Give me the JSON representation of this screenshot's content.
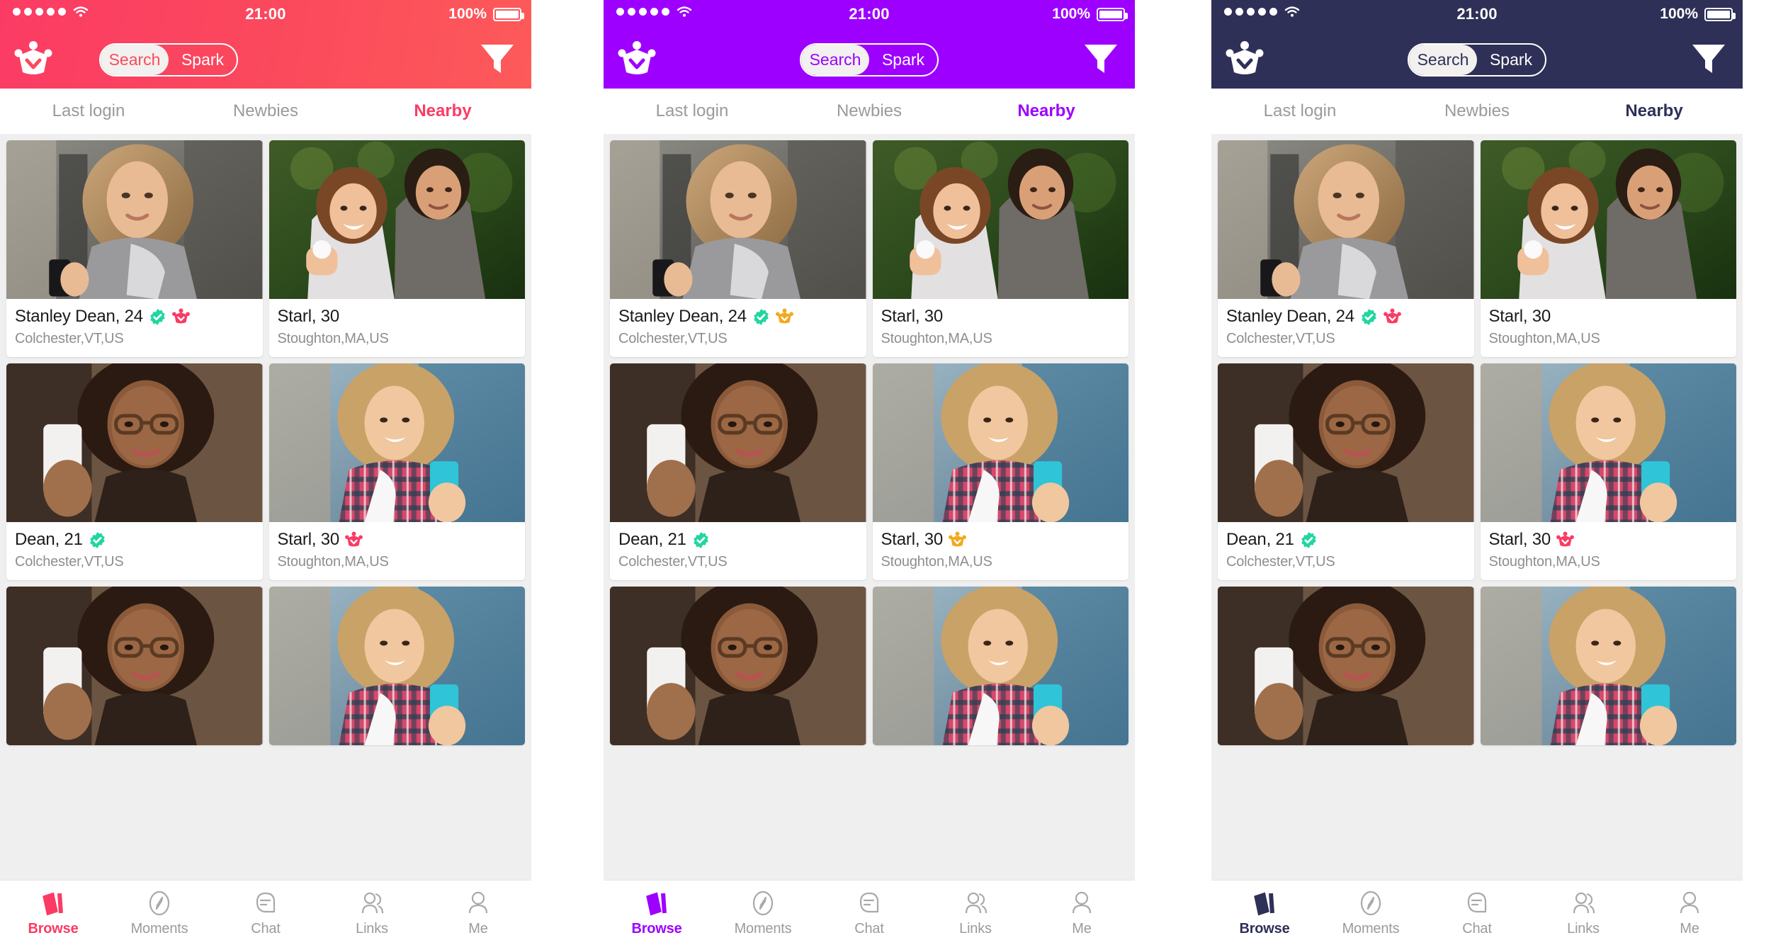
{
  "panels": [
    {
      "theme_name": "pink",
      "accent": "#fb3b64",
      "header_bg": "#fb4a5c",
      "crown_badge_color": "#fb3b64",
      "status": {
        "time": "21:00",
        "battery_percent": "100%",
        "signal_dots": 5,
        "wifi": "wifi-icon"
      },
      "navbar": {
        "logo": "crown-logo-icon",
        "filter": "filter-funnel-icon",
        "segments": [
          {
            "label": "Search",
            "selected": true
          },
          {
            "label": "Spark",
            "selected": false
          }
        ]
      },
      "tabs": [
        {
          "label": "Last login",
          "active": false
        },
        {
          "label": "Newbies",
          "active": false
        },
        {
          "label": "Nearby",
          "active": true
        }
      ],
      "cards": [
        {
          "name": "Stanley Dean, 24",
          "location": "Colchester,VT,US",
          "badges": [
            "verified",
            "crown"
          ],
          "photo": "woman-scarf-phone"
        },
        {
          "name": "Starl, 30",
          "location": "Stoughton,MA,US",
          "badges": [],
          "photo": "couple-hug"
        },
        {
          "name": "Dean, 21",
          "location": "Colchester,VT,US",
          "badges": [
            "verified"
          ],
          "photo": "woman-glasses-curly"
        },
        {
          "name": "Starl, 30",
          "location": "Stoughton,MA,US",
          "badges": [
            "crown"
          ],
          "photo": "woman-plaid-phone"
        }
      ],
      "tabbar": [
        {
          "label": "Browse",
          "icon": "cards-icon",
          "active": true
        },
        {
          "label": "Moments",
          "icon": "compass-icon",
          "active": false
        },
        {
          "label": "Chat",
          "icon": "chat-bubble-icon",
          "active": false
        },
        {
          "label": "Links",
          "icon": "two-people-icon",
          "active": false
        },
        {
          "label": "Me",
          "icon": "person-icon",
          "active": false
        }
      ]
    },
    {
      "theme_name": "purple",
      "accent": "#9d00ff",
      "header_bg": "#9d00ff",
      "crown_badge_color": "#f2a91d",
      "status": {
        "time": "21:00",
        "battery_percent": "100%",
        "signal_dots": 5,
        "wifi": "wifi-icon"
      },
      "navbar": {
        "logo": "crown-logo-icon",
        "filter": "filter-funnel-icon",
        "segments": [
          {
            "label": "Search",
            "selected": true
          },
          {
            "label": "Spark",
            "selected": false
          }
        ]
      },
      "tabs": [
        {
          "label": "Last login",
          "active": false
        },
        {
          "label": "Newbies",
          "active": false
        },
        {
          "label": "Nearby",
          "active": true
        }
      ],
      "cards": [
        {
          "name": "Stanley Dean, 24",
          "location": "Colchester,VT,US",
          "badges": [
            "verified",
            "crown"
          ],
          "photo": "woman-scarf-phone"
        },
        {
          "name": "Starl, 30",
          "location": "Stoughton,MA,US",
          "badges": [],
          "photo": "couple-hug"
        },
        {
          "name": "Dean, 21",
          "location": "Colchester,VT,US",
          "badges": [
            "verified"
          ],
          "photo": "woman-glasses-curly"
        },
        {
          "name": "Starl, 30",
          "location": "Stoughton,MA,US",
          "badges": [
            "crown"
          ],
          "photo": "woman-plaid-phone"
        }
      ],
      "tabbar": [
        {
          "label": "Browse",
          "icon": "cards-icon",
          "active": true
        },
        {
          "label": "Moments",
          "icon": "compass-icon",
          "active": false
        },
        {
          "label": "Chat",
          "icon": "chat-bubble-icon",
          "active": false
        },
        {
          "label": "Links",
          "icon": "two-people-icon",
          "active": false
        },
        {
          "label": "Me",
          "icon": "person-icon",
          "active": false
        }
      ]
    },
    {
      "theme_name": "navy",
      "accent": "#2e3057",
      "header_bg": "#2e3057",
      "crown_badge_color": "#fb3b64",
      "status": {
        "time": "21:00",
        "battery_percent": "100%",
        "signal_dots": 5,
        "wifi": "wifi-icon"
      },
      "navbar": {
        "logo": "crown-logo-icon",
        "filter": "filter-funnel-icon",
        "segments": [
          {
            "label": "Search",
            "selected": true
          },
          {
            "label": "Spark",
            "selected": false
          }
        ]
      },
      "tabs": [
        {
          "label": "Last login",
          "active": false
        },
        {
          "label": "Newbies",
          "active": false
        },
        {
          "label": "Nearby",
          "active": true
        }
      ],
      "cards": [
        {
          "name": "Stanley Dean, 24",
          "location": "Colchester,VT,US",
          "badges": [
            "verified",
            "crown"
          ],
          "photo": "woman-scarf-phone"
        },
        {
          "name": "Starl, 30",
          "location": "Stoughton,MA,US",
          "badges": [],
          "photo": "couple-hug"
        },
        {
          "name": "Dean, 21",
          "location": "Colchester,VT,US",
          "badges": [
            "verified"
          ],
          "photo": "woman-glasses-curly"
        },
        {
          "name": "Starl, 30",
          "location": "Stoughton,MA,US",
          "badges": [
            "crown"
          ],
          "photo": "woman-plaid-phone"
        }
      ],
      "tabbar": [
        {
          "label": "Browse",
          "icon": "cards-icon",
          "active": true
        },
        {
          "label": "Moments",
          "icon": "compass-icon",
          "active": false
        },
        {
          "label": "Chat",
          "icon": "chat-bubble-icon",
          "active": false
        },
        {
          "label": "Links",
          "icon": "two-people-icon",
          "active": false
        },
        {
          "label": "Me",
          "icon": "person-icon",
          "active": false
        }
      ]
    }
  ],
  "colors": {
    "verified_badge": "#21d6a0",
    "inactive_text": "#9a9a9a",
    "grid_bg": "#efefef"
  }
}
